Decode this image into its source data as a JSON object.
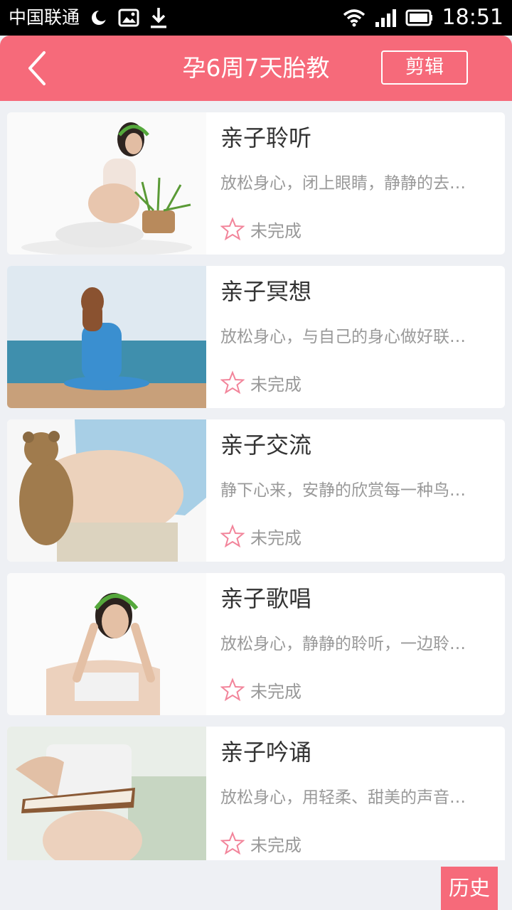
{
  "status_bar": {
    "carrier": "中国联通",
    "time": "18:51"
  },
  "header": {
    "title": "孕6周7天胎教",
    "edit_label": "剪辑"
  },
  "items": [
    {
      "title": "亲子聆听",
      "desc": "放松身心，闭上眼睛，静静的去…",
      "status": "未完成"
    },
    {
      "title": "亲子冥想",
      "desc": "放松身心，与自己的身心做好联…",
      "status": "未完成"
    },
    {
      "title": "亲子交流",
      "desc": "静下心来，安静的欣赏每一种鸟…",
      "status": "未完成"
    },
    {
      "title": "亲子歌唱",
      "desc": "放松身心，静静的聆听，一边聆…",
      "status": "未完成"
    },
    {
      "title": "亲子吟诵",
      "desc": "放松身心，用轻柔、甜美的声音…",
      "status": "未完成"
    }
  ],
  "history_label": "历史",
  "colors": {
    "accent": "#f66a7a",
    "background": "#eef0f4"
  }
}
